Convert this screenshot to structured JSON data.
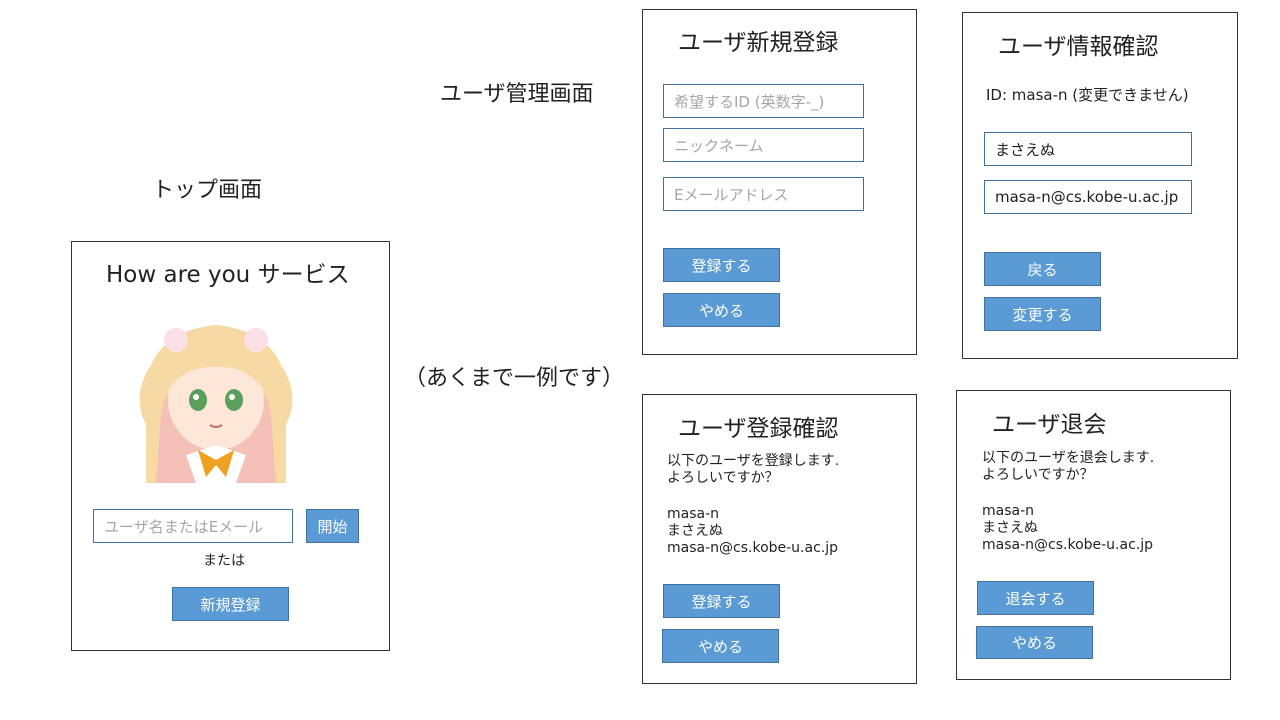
{
  "captions": {
    "top_screen": "トップ画面",
    "user_admin_screen": "ユーザ管理画面",
    "example_note": "（あくまで一例です）"
  },
  "top": {
    "title": "How are you サービス",
    "login_placeholder": "ユーザ名またはEメール",
    "start_button": "開始",
    "or_text": "または",
    "register_button": "新規登録"
  },
  "register": {
    "title": "ユーザ新規登録",
    "id_placeholder": "希望するID (英数字-_)",
    "nickname_placeholder": "ニックネーム",
    "email_placeholder": "Eメールアドレス",
    "submit_button": "登録する",
    "cancel_button": "やめる"
  },
  "info": {
    "title": "ユーザ情報確認",
    "id_line": "ID: masa-n (変更できません)",
    "nickname_value": "まさえぬ",
    "email_value": "masa-n@cs.kobe-u.ac.jp",
    "back_button": "戻る",
    "change_button": "変更する"
  },
  "confirm": {
    "title": "ユーザ登録確認",
    "message_line1": "以下のユーザを登録します.",
    "message_line2": "よろしいですか？",
    "user_id": "masa-n",
    "nickname": "まさえぬ",
    "email": "masa-n@cs.kobe-u.ac.jp",
    "submit_button": "登録する",
    "cancel_button": "やめる"
  },
  "withdraw": {
    "title": "ユーザ退会",
    "message_line1": "以下のユーザを退会します.",
    "message_line2": "よろしいですか？",
    "user_id": "masa-n",
    "nickname": "まさえぬ",
    "email": "masa-n@cs.kobe-u.ac.jp",
    "withdraw_button": "退会する",
    "cancel_button": "やめる"
  },
  "colors": {
    "button_fill": "#5b9bd5",
    "button_border": "#41719c",
    "panel_border": "#333333",
    "placeholder_text": "#a6a6a6"
  }
}
